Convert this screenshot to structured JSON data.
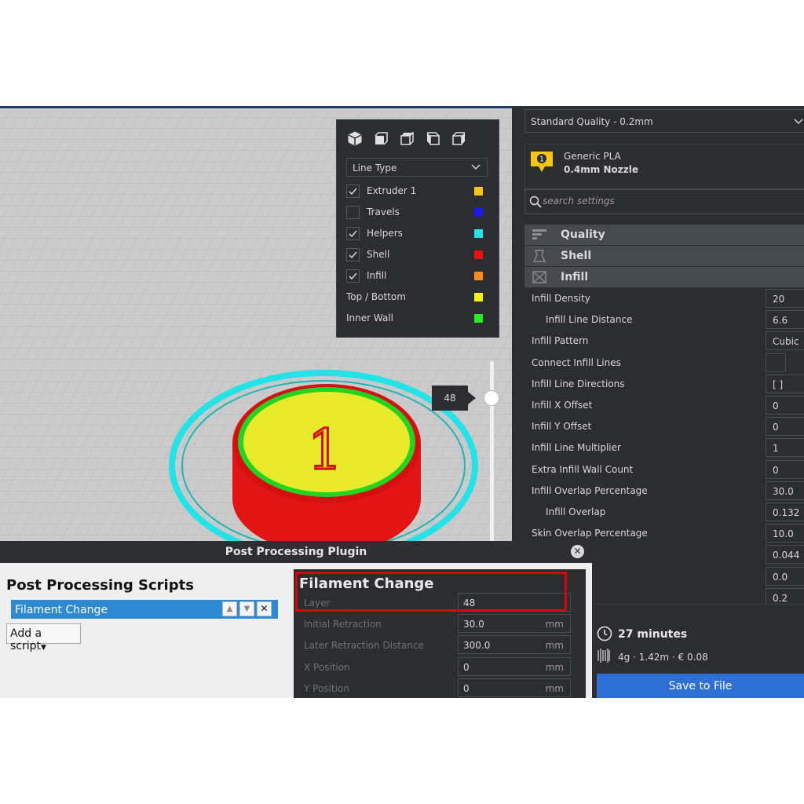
{
  "view_panel": {
    "line_type_label": "Line Type",
    "legend": [
      {
        "label": "Extruder 1",
        "checked": true,
        "has_checkbox": true,
        "color": "#f5c518"
      },
      {
        "label": "Travels",
        "checked": false,
        "has_checkbox": true,
        "color": "#1a1aff"
      },
      {
        "label": "Helpers",
        "checked": true,
        "has_checkbox": true,
        "color": "#22e3e8"
      },
      {
        "label": "Shell",
        "checked": true,
        "has_checkbox": true,
        "color": "#ee1111"
      },
      {
        "label": "Infill",
        "checked": true,
        "has_checkbox": true,
        "color": "#ff8c1a"
      },
      {
        "label": "Top / Bottom",
        "checked": false,
        "has_checkbox": false,
        "color": "#f2f21a"
      },
      {
        "label": "Inner Wall",
        "checked": false,
        "has_checkbox": false,
        "color": "#22ee22"
      }
    ]
  },
  "layer_slider": {
    "value": "48"
  },
  "model": {
    "number_text": "1"
  },
  "settings": {
    "quality_profile": "Standard Quality - 0.2mm",
    "material_name": "Generic PLA",
    "nozzle": "0.4mm Nozzle",
    "extruder_badge": "1",
    "search_placeholder": "search settings",
    "categories": [
      "Quality",
      "Shell",
      "Infill"
    ],
    "rows": [
      {
        "label": "Infill Density",
        "value": "20",
        "indent": false
      },
      {
        "label": "Infill Line Distance",
        "value": "6.6",
        "indent": true
      },
      {
        "label": "Infill Pattern",
        "value": "Cubic",
        "indent": false
      },
      {
        "label": "Connect Infill Lines",
        "value": "",
        "indent": false,
        "checkbox": true
      },
      {
        "label": "Infill Line Directions",
        "value": "[ ]",
        "indent": false
      },
      {
        "label": "Infill X Offset",
        "value": "0",
        "indent": false
      },
      {
        "label": "Infill Y Offset",
        "value": "0",
        "indent": false
      },
      {
        "label": "Infill Line Multiplier",
        "value": "1",
        "indent": false
      },
      {
        "label": "Extra Infill Wall Count",
        "value": "0",
        "indent": false
      },
      {
        "label": "Infill Overlap Percentage",
        "value": "30.0",
        "indent": false
      },
      {
        "label": "Infill Overlap",
        "value": "0.132",
        "indent": true
      },
      {
        "label": "Skin Overlap Percentage",
        "value": "10.0",
        "indent": false
      },
      {
        "label": "",
        "value": "0.044",
        "indent": false
      },
      {
        "label": "",
        "value": "0.0",
        "indent": false
      },
      {
        "label": "",
        "value": "0.2",
        "indent": false
      }
    ],
    "print_time": "27 minutes",
    "material_estimate": "4g · 1.42m · € 0.08",
    "save_label": "Save to File"
  },
  "dialog": {
    "title": "Post Processing Plugin",
    "heading": "Post Processing Scripts",
    "scripts": [
      "Filament Change"
    ],
    "add_script_label": "Add a script",
    "script_title": "Filament Change",
    "params": [
      {
        "label": "Layer",
        "value": "48",
        "unit": ""
      },
      {
        "label": "Initial Retraction",
        "value": "30.0",
        "unit": "mm"
      },
      {
        "label": "Later Retraction Distance",
        "value": "300.0",
        "unit": "mm"
      },
      {
        "label": "X Position",
        "value": "0",
        "unit": "mm"
      },
      {
        "label": "Y Position",
        "value": "0",
        "unit": "mm"
      }
    ]
  }
}
